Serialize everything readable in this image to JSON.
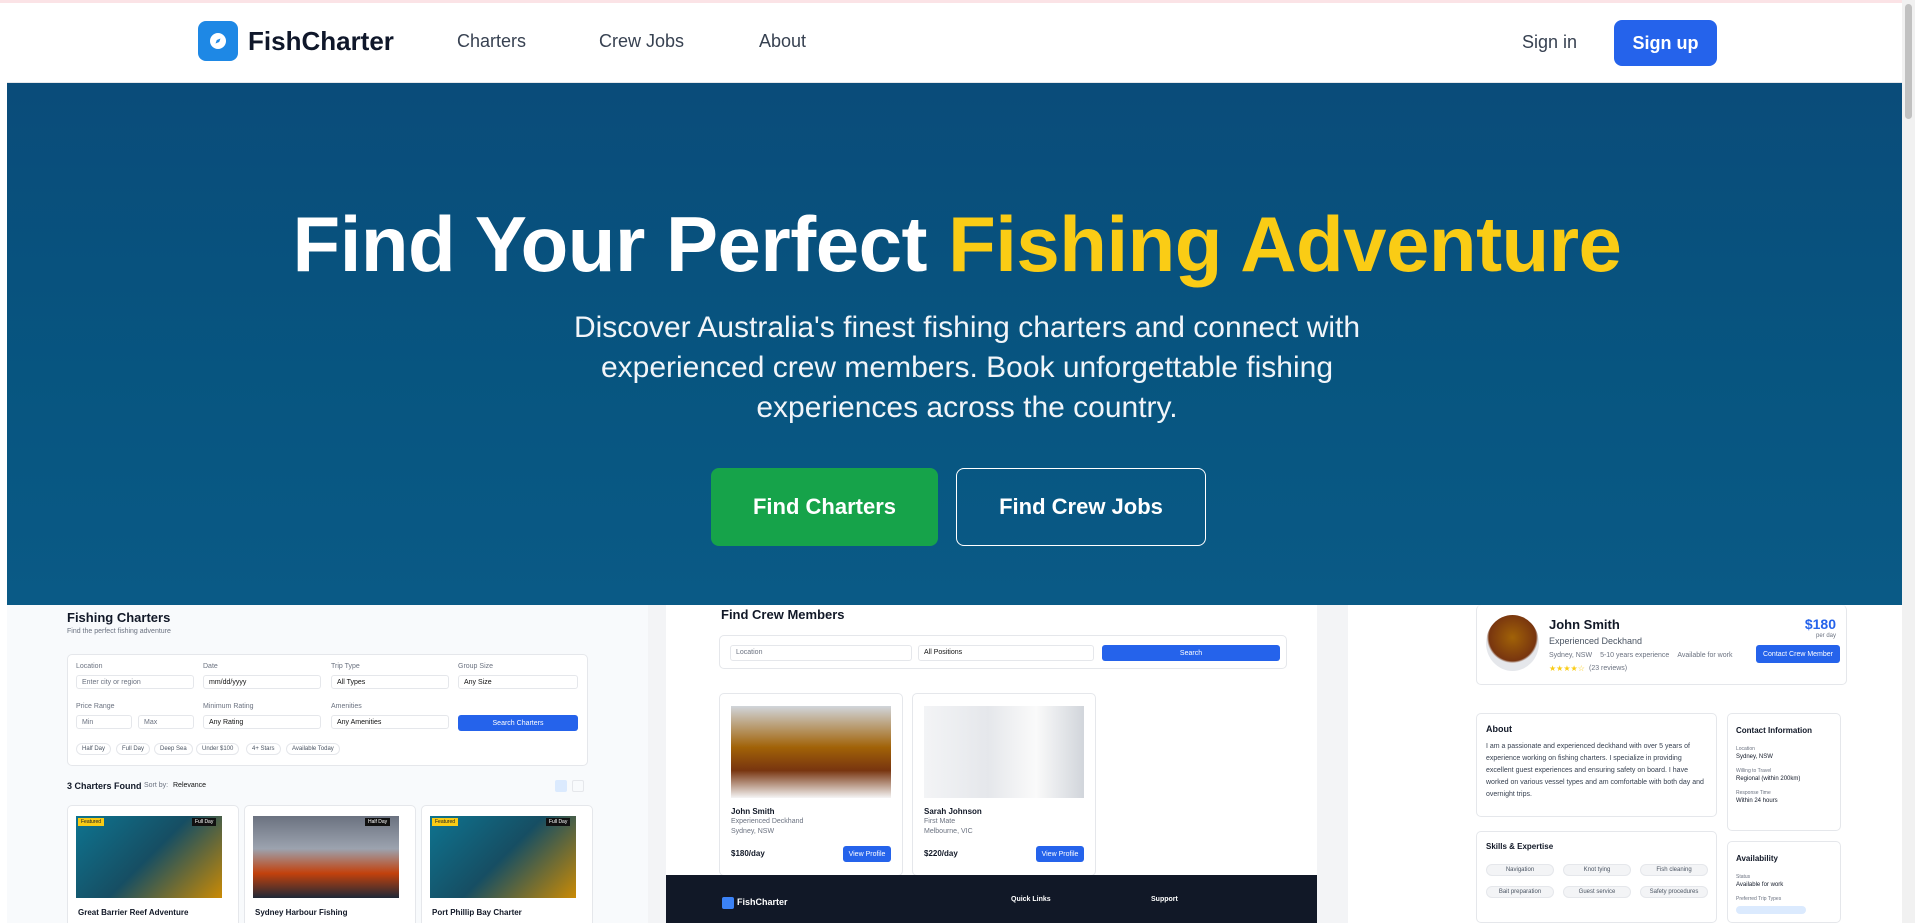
{
  "colors": {
    "primary": "#2563eb",
    "accent": "#facc15",
    "green": "#16a34a",
    "hero_bg": "#075580"
  },
  "nav": {
    "brand": "FishCharter",
    "links": [
      "Charters",
      "Crew Jobs",
      "About"
    ],
    "signin": "Sign in",
    "signup": "Sign up"
  },
  "hero": {
    "title_main": "Find Your Perfect ",
    "title_accent": "Fishing Adventure",
    "subtitle": "Discover Australia's finest fishing charters and connect with experienced crew members. Book unforgettable fishing experiences across the country.",
    "btn_charters": "Find Charters",
    "btn_crew": "Find Crew Jobs"
  },
  "charters_panel": {
    "title": "Fishing Charters",
    "subtitle": "Find the perfect fishing adventure",
    "labels": {
      "location": "Location",
      "date": "Date",
      "trip_type": "Trip Type",
      "group_size": "Group Size",
      "price_range": "Price Range",
      "min_rating": "Minimum Rating",
      "amenities": "Amenities"
    },
    "placeholders": {
      "location": "Enter city or region",
      "date": "mm/dd/yyyy",
      "min": "Min",
      "max": "Max"
    },
    "selects": {
      "trip_type": "All Types",
      "group_size": "Any Size",
      "rating": "Any Rating",
      "amenities": "Any Amenities"
    },
    "search_btn": "Search Charters",
    "chips": [
      "Half Day",
      "Full Day",
      "Deep Sea",
      "Under $100",
      "4+ Stars",
      "Available Today"
    ],
    "found": "3 Charters Found",
    "sort_label": "Sort by:",
    "sort_value": "Relevance",
    "cards": [
      {
        "name": "Great Barrier Reef Adventure",
        "badge_left": "Featured",
        "badge_right": "Full Day"
      },
      {
        "name": "Sydney Harbour Fishing",
        "badge_left": "",
        "badge_right": "Half Day"
      },
      {
        "name": "Port Phillip Bay Charter",
        "badge_left": "Featured",
        "badge_right": "Full Day"
      }
    ]
  },
  "crew_panel": {
    "title": "Find Crew Members",
    "location_placeholder": "Location",
    "positions": "All Positions",
    "search": "Search",
    "members": [
      {
        "name": "John Smith",
        "role": "Experienced Deckhand",
        "location": "Sydney, NSW",
        "rate": "$180/day",
        "btn": "View Profile"
      },
      {
        "name": "Sarah Johnson",
        "role": "First Mate",
        "location": "Melbourne, VIC",
        "rate": "$220/day",
        "btn": "View Profile"
      }
    ],
    "footer": {
      "brand": "FishCharter",
      "quick_links": "Quick Links",
      "support": "Support"
    }
  },
  "profile_panel": {
    "name": "John Smith",
    "role": "Experienced Deckhand",
    "meta": [
      "Sydney, NSW",
      "5-10 years experience",
      "Available for work"
    ],
    "stars": "★★★★☆",
    "rating_fill": 0.8,
    "reviews": "(23 reviews)",
    "price": "$180",
    "per_day": "per day",
    "contact_btn": "Contact Crew Member",
    "about_title": "About",
    "about_text": "I am a passionate and experienced deckhand with over 5 years of experience working on fishing charters. I specialize in providing excellent guest experiences and ensuring safety on board. I have worked on various vessel types and am comfortable with both day and overnight trips.",
    "contact_title": "Contact Information",
    "contact": [
      {
        "label": "Location",
        "value": "Sydney, NSW"
      },
      {
        "label": "Willing to Travel",
        "value": "Regional (within 200km)"
      },
      {
        "label": "Response Time",
        "value": "Within 24 hours"
      }
    ],
    "skills_title": "Skills & Expertise",
    "skills": [
      "Navigation",
      "Knot tying",
      "Fish cleaning",
      "Bait preparation",
      "Guest service",
      "Safety procedures"
    ],
    "availability_title": "Availability",
    "status_label": "Status",
    "status_value": "Available for work",
    "trip_types_label": "Preferred Trip Types"
  }
}
